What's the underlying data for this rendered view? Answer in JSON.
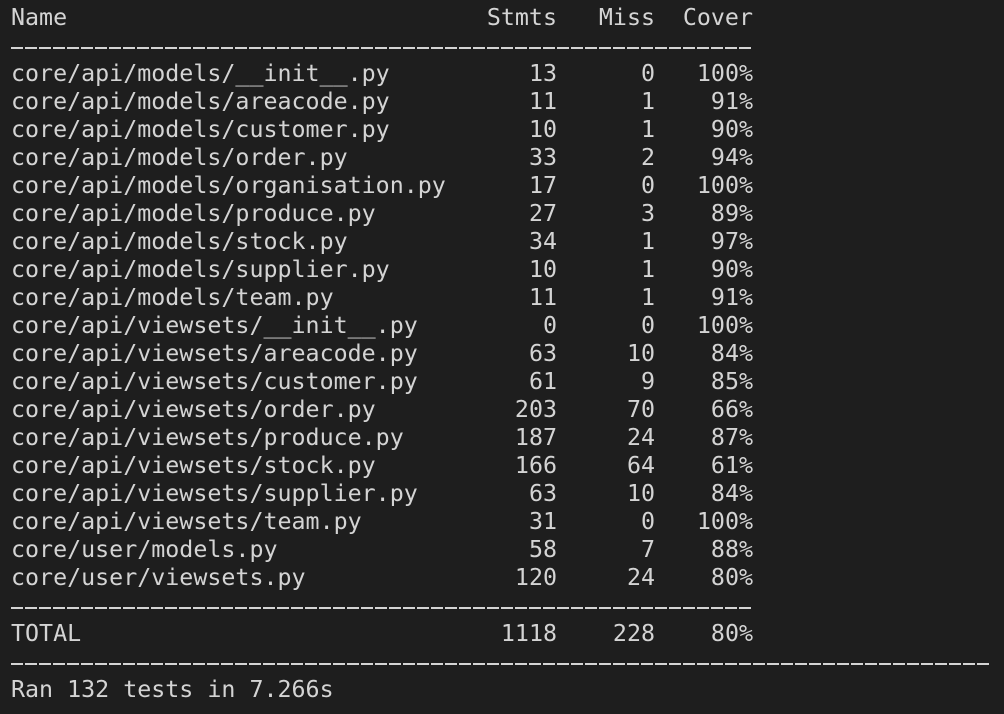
{
  "header": {
    "name": "Name",
    "stmts": "Stmts",
    "miss": "Miss",
    "cover": "Cover"
  },
  "rows": [
    {
      "name": "core/api/models/__init__.py",
      "stmts": "13",
      "miss": "0",
      "cover": "100%"
    },
    {
      "name": "core/api/models/areacode.py",
      "stmts": "11",
      "miss": "1",
      "cover": "91%"
    },
    {
      "name": "core/api/models/customer.py",
      "stmts": "10",
      "miss": "1",
      "cover": "90%"
    },
    {
      "name": "core/api/models/order.py",
      "stmts": "33",
      "miss": "2",
      "cover": "94%"
    },
    {
      "name": "core/api/models/organisation.py",
      "stmts": "17",
      "miss": "0",
      "cover": "100%"
    },
    {
      "name": "core/api/models/produce.py",
      "stmts": "27",
      "miss": "3",
      "cover": "89%"
    },
    {
      "name": "core/api/models/stock.py",
      "stmts": "34",
      "miss": "1",
      "cover": "97%"
    },
    {
      "name": "core/api/models/supplier.py",
      "stmts": "10",
      "miss": "1",
      "cover": "90%"
    },
    {
      "name": "core/api/models/team.py",
      "stmts": "11",
      "miss": "1",
      "cover": "91%"
    },
    {
      "name": "core/api/viewsets/__init__.py",
      "stmts": "0",
      "miss": "0",
      "cover": "100%"
    },
    {
      "name": "core/api/viewsets/areacode.py",
      "stmts": "63",
      "miss": "10",
      "cover": "84%"
    },
    {
      "name": "core/api/viewsets/customer.py",
      "stmts": "61",
      "miss": "9",
      "cover": "85%"
    },
    {
      "name": "core/api/viewsets/order.py",
      "stmts": "203",
      "miss": "70",
      "cover": "66%"
    },
    {
      "name": "core/api/viewsets/produce.py",
      "stmts": "187",
      "miss": "24",
      "cover": "87%"
    },
    {
      "name": "core/api/viewsets/stock.py",
      "stmts": "166",
      "miss": "64",
      "cover": "61%"
    },
    {
      "name": "core/api/viewsets/supplier.py",
      "stmts": "63",
      "miss": "10",
      "cover": "84%"
    },
    {
      "name": "core/api/viewsets/team.py",
      "stmts": "31",
      "miss": "0",
      "cover": "100%"
    },
    {
      "name": "core/user/models.py",
      "stmts": "58",
      "miss": "7",
      "cover": "88%"
    },
    {
      "name": "core/user/viewsets.py",
      "stmts": "120",
      "miss": "24",
      "cover": "80%"
    }
  ],
  "total": {
    "name": "TOTAL",
    "stmts": "1118",
    "miss": "228",
    "cover": "80%"
  },
  "summary": "Ran 132 tests in 7.266s"
}
